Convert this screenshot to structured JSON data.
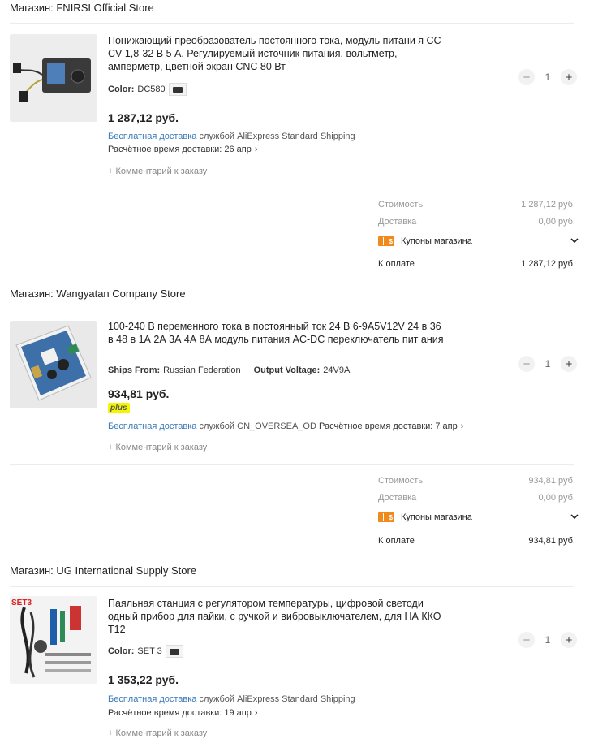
{
  "stores": [
    {
      "title": "Магазин: FNIRSI Official Store",
      "product": {
        "name": "Понижающий преобразователь постоянного тока, модуль питани я CC CV 1,8-32 В 5 А, Регулируемый источник питания, вольтметр, амперметр, цветной экран CNC 80 Вт",
        "specs": [
          {
            "label": "Color:",
            "value": "DC580"
          }
        ],
        "price": "1 287,12 руб.",
        "shipping_free": "Бесплатная доставка",
        "shipping_service": "службой AliExpress Standard Shipping",
        "eta": "Расчётное время доставки: 26 апр",
        "comment": "Комментарий к заказу",
        "quantity": "1"
      },
      "summary": {
        "cost_label": "Стоимость",
        "cost_value": "1 287,12 руб.",
        "delivery_label": "Доставка",
        "delivery_value": "0,00 руб.",
        "coupons_label": "Купоны магазина",
        "total_label": "К оплате",
        "total_value": "1 287,12 руб."
      }
    },
    {
      "title": "Магазин: Wangyatan Company Store",
      "product": {
        "name": "100-240 В переменного тока в постоянный ток 24 В 6-9А5V12V 24 в 36 в 48 в 1А 2А 3А 4А 8А модуль питания AC-DC переключатель пит ания",
        "specs": [
          {
            "label": "Ships From:",
            "value": "Russian Federation"
          },
          {
            "label": "Output Voltage:",
            "value": "24V9A"
          }
        ],
        "price": "934,81 руб.",
        "badge": "plus",
        "shipping_free": "Бесплатная доставка",
        "shipping_service": "службой CN_OVERSEA_OD",
        "eta": "Расчётное время доставки: 7 апр",
        "comment": "Комментарий к заказу",
        "quantity": "1"
      },
      "summary": {
        "cost_label": "Стоимость",
        "cost_value": "934,81 руб.",
        "delivery_label": "Доставка",
        "delivery_value": "0,00 руб.",
        "coupons_label": "Купоны магазина",
        "total_label": "К оплате",
        "total_value": "934,81 руб."
      }
    },
    {
      "title": "Магазин: UG International Supply Store",
      "product": {
        "name": "Паяльная станция с регулятором температуры, цифровой светоди одный прибор для пайки, с ручкой и вибровыключателем, для НА ККО Т12",
        "specs": [
          {
            "label": "Color:",
            "value": "SET 3"
          }
        ],
        "image_label": "SET3",
        "price": "1 353,22 руб.",
        "shipping_free": "Бесплатная доставка",
        "shipping_service": "службой AliExpress Standard Shipping",
        "eta": "Расчётное время доставки: 19 апр",
        "comment": "Комментарий к заказу",
        "quantity": "1"
      }
    }
  ],
  "icons": {
    "qty_minus": "minus-icon",
    "qty_plus": "plus-icon",
    "coupon": "coupon-icon",
    "chevron_down": "chevron-down-icon",
    "chevron_right": "chevron-right-icon"
  },
  "colors": {
    "link": "#3a7ab8",
    "coupon": "#f08a1c",
    "plus_badge": "#f5f500"
  }
}
